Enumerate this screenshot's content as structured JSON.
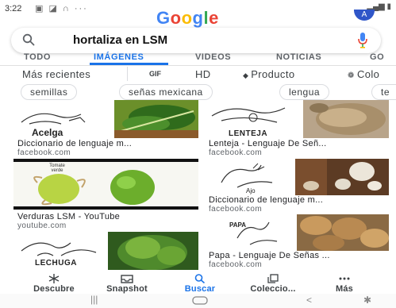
{
  "status": {
    "time": "3:22",
    "left_icons": "▣ ◪ ∩ ···",
    "right_icons": "▂▄▆ ▮",
    "avatar_letter": "A"
  },
  "logo": {
    "letters": [
      "G",
      "o",
      "o",
      "g",
      "l",
      "e"
    ],
    "colors": [
      "#4285f4",
      "#ea4335",
      "#fbbc05",
      "#4285f4",
      "#34a853",
      "#ea4335"
    ]
  },
  "search": {
    "query": "hortaliza en LSM"
  },
  "tabs": [
    {
      "label": "TODO"
    },
    {
      "label": "IMÁGENES"
    },
    {
      "label": "VIDEOS"
    },
    {
      "label": "NOTICIAS"
    },
    {
      "label": "GO"
    }
  ],
  "filters": [
    {
      "label": "Más recientes"
    },
    {
      "label": "GIF"
    },
    {
      "label": "HD"
    },
    {
      "label": "Producto"
    },
    {
      "label": "Colo"
    }
  ],
  "chips": [
    {
      "label": "semillas"
    },
    {
      "label": "señas mexicana"
    },
    {
      "label": "lengua"
    },
    {
      "label": "te"
    }
  ],
  "results": [
    {
      "image_label": "Acelga",
      "title": "Diccionario de lenguaje m...",
      "source": "facebook.com"
    },
    {
      "image_label": "LENTEJA",
      "title": "Lenteja - Lenguaje De Señ...",
      "source": "facebook.com"
    },
    {
      "image_label": "Tomate verde",
      "title": "Verduras LSM - YouTube",
      "source": "youtube.com"
    },
    {
      "image_label": "Ajo",
      "title": "Diccionario de lenguaje m...",
      "source": "facebook.com"
    },
    {
      "image_label": "LECHUGA",
      "title": "",
      "source": ""
    },
    {
      "image_label": "PAPA",
      "title": "Papa - Lenguaje De Señas ...",
      "source": "facebook.com"
    }
  ],
  "bottom_nav": [
    {
      "label": "Descubre"
    },
    {
      "label": "Snapshot"
    },
    {
      "label": "Buscar"
    },
    {
      "label": "Coleccio..."
    },
    {
      "label": "Más"
    }
  ],
  "colors": {
    "accent": "#1a73e8",
    "text": "#202124",
    "muted": "#5f6368"
  }
}
